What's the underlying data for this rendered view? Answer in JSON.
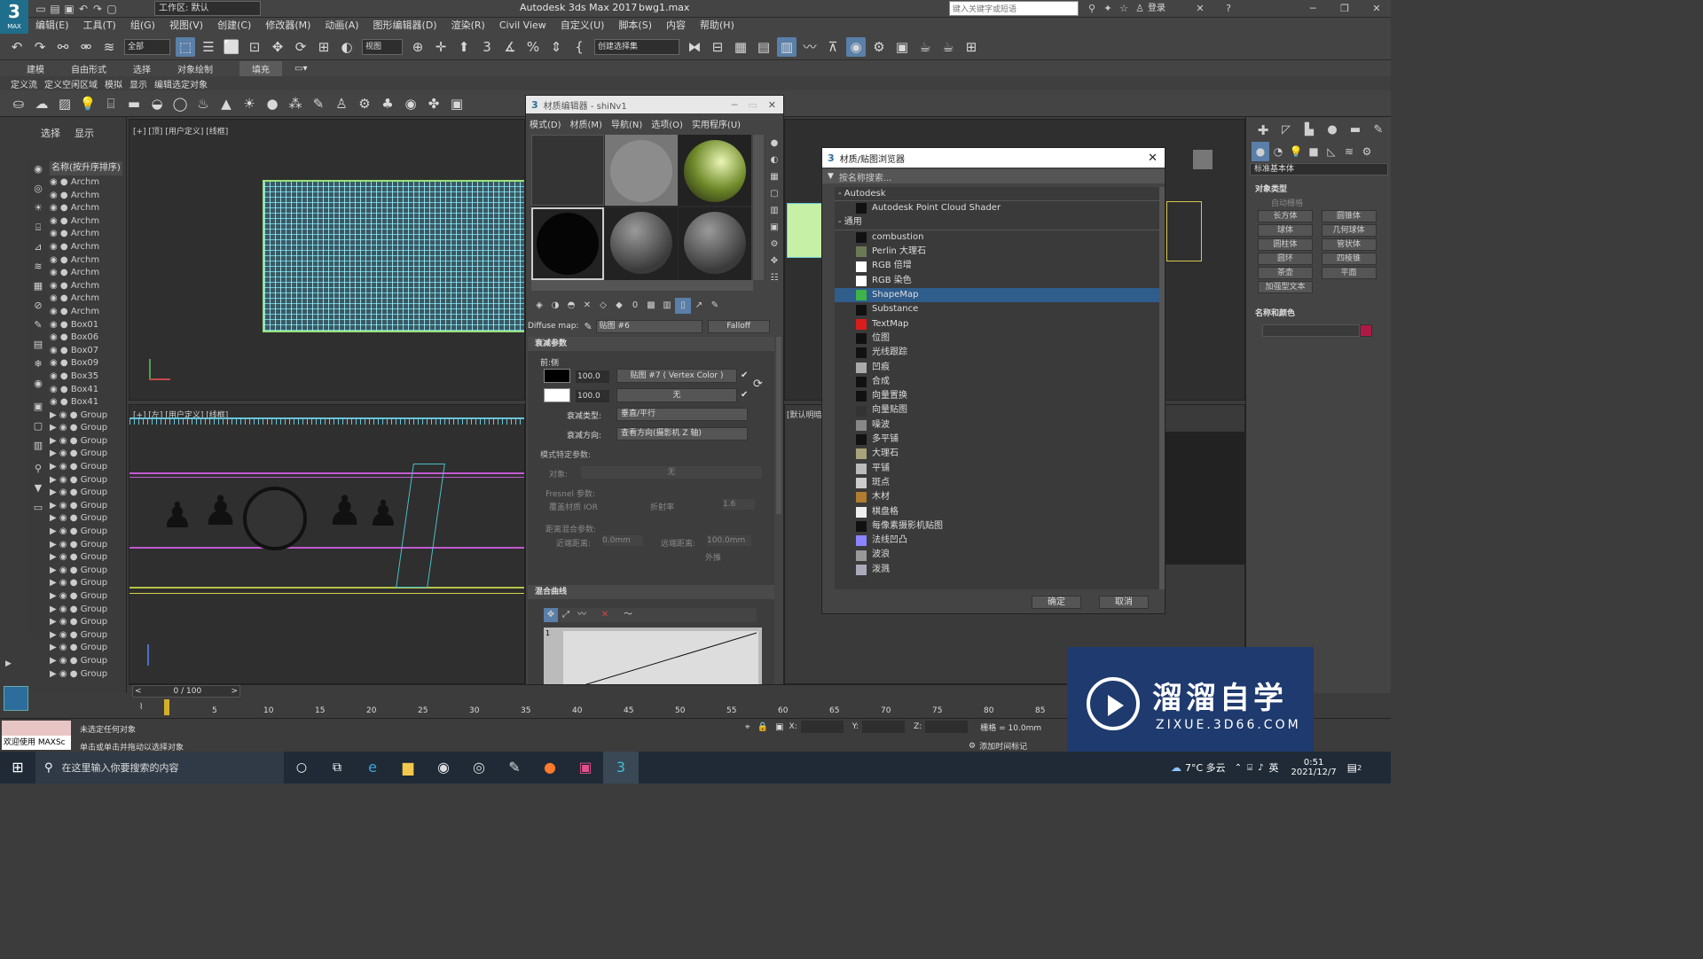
{
  "app": {
    "logo": "3",
    "logo_sub": "MAX",
    "workspace": "工作区: 默认",
    "title": "Autodesk 3ds Max 2017",
    "file": "bwg1.max",
    "search_placeholder": "键入关键字或短语",
    "login": "登录"
  },
  "menu": [
    "编辑(E)",
    "工具(T)",
    "组(G)",
    "视图(V)",
    "创建(C)",
    "修改器(M)",
    "动画(A)",
    "图形编辑器(D)",
    "渲染(R)",
    "Civil View",
    "自定义(U)",
    "脚本(S)",
    "内容",
    "帮助(H)"
  ],
  "toolbar": {
    "filter": "全部",
    "viewref": "视图",
    "selset": "创建选择集"
  },
  "ribbon_tabs": [
    "建模",
    "自由形式",
    "选择",
    "对象绘制",
    "填充"
  ],
  "ribbon_sub": [
    "定义流",
    "定义空闲区域",
    "模拟",
    "显示",
    "编辑选定对象"
  ],
  "scene": {
    "tabs": [
      "选择",
      "显示"
    ],
    "header": "名称(按升序排序)",
    "items": [
      "Archm",
      "Archm",
      "Archm",
      "Archm",
      "Archm",
      "Archm",
      "Archm",
      "Archm",
      "Archm",
      "Archm",
      "Archm",
      "Box01",
      "Box06",
      "Box07",
      "Box09",
      "Box35",
      "Box41",
      "Box41",
      "Group",
      "Group",
      "Group",
      "Group",
      "Group",
      "Group",
      "Group",
      "Group",
      "Group",
      "Group",
      "Group",
      "Group",
      "Group",
      "Group",
      "Group",
      "Group",
      "Group",
      "Group",
      "Group",
      "Group",
      "Group",
      "Grou"
    ]
  },
  "viewports": {
    "top_label": "[+] [顶] [用户定义] [线框]",
    "front_label": "[+] [左] [用户定义] [线框]",
    "persp_label": "[默认明暗处"
  },
  "mat_editor": {
    "title": "材质编辑器 - shiNv1",
    "menus": [
      "模式(D)",
      "材质(M)",
      "导航(N)",
      "选项(O)",
      "实用程序(U)"
    ],
    "diffuse_label": "Diffuse map:",
    "map_name": "贴图 #6",
    "map_type": "Falloff",
    "rollout1": "衰减参数",
    "front_side": "前:侧",
    "amt1": "100.0",
    "map1": "贴图 #7 ( Vertex Color )",
    "amt2": "100.0",
    "map2": "无",
    "falloff_type_label": "衰减类型:",
    "falloff_type": "垂直/平行",
    "falloff_dir_label": "衰减方向:",
    "falloff_dir": "查看方向(摄影机 Z 轴)",
    "mode_params": "模式特定参数:",
    "object_label": "对象:",
    "object_val": "无",
    "fresnel": "Fresnel 参数:",
    "override_ior": "覆盖材质 IOR",
    "ior_label": "折射率",
    "ior_val": "1.6",
    "dist_blend": "距离混合参数:",
    "near_label": "近端距离:",
    "near_val": "0.0mm",
    "far_label": "远端距离:",
    "far_val": "100.0mm",
    "extrapolate": "外推",
    "rollout2": "混合曲线",
    "curve_y": "1"
  },
  "browser": {
    "title": "材质/贴图浏览器",
    "search": "按名称搜索...",
    "groups": [
      {
        "name": "Autodesk",
        "items": [
          {
            "label": "Autodesk Point Cloud Shader",
            "color": "#111"
          }
        ]
      },
      {
        "name": "通用",
        "items": [
          {
            "label": "combustion",
            "color": "#111"
          },
          {
            "label": "Perlin 大理石",
            "color": "#6b7a55"
          },
          {
            "label": "RGB 倍增",
            "color": "#fff"
          },
          {
            "label": "RGB 染色",
            "color": "#fff"
          },
          {
            "label": "ShapeMap",
            "color": "#3db34a"
          },
          {
            "label": "Substance",
            "color": "#111"
          },
          {
            "label": "TextMap",
            "color": "#d91c1c"
          },
          {
            "label": "位图",
            "color": "#111"
          },
          {
            "label": "光线跟踪",
            "color": "#111"
          },
          {
            "label": "凹痕",
            "color": "#aaa"
          },
          {
            "label": "合成",
            "color": "#111"
          },
          {
            "label": "向量置换",
            "color": "#111"
          },
          {
            "label": "向量贴图",
            "color": "#333"
          },
          {
            "label": "噪波",
            "color": "#888"
          },
          {
            "label": "多平铺",
            "color": "#111"
          },
          {
            "label": "大理石",
            "color": "#a7a37a"
          },
          {
            "label": "平铺",
            "color": "#bbb"
          },
          {
            "label": "斑点",
            "color": "#ccc"
          },
          {
            "label": "木材",
            "color": "#b07c30"
          },
          {
            "label": "棋盘格",
            "color": "#eee"
          },
          {
            "label": "每像素摄影机贴图",
            "color": "#111"
          },
          {
            "label": "法线凹凸",
            "color": "#8a85ff"
          },
          {
            "label": "波浪",
            "color": "#999"
          },
          {
            "label": "泼溅",
            "color": "#aab"
          }
        ]
      }
    ],
    "ok": "确定",
    "cancel": "取消"
  },
  "cmd": {
    "dropdown": "标准基本体",
    "rollout1": "对象类型",
    "autogrid": "自动栅格",
    "buttons": [
      "长方体",
      "圆锥体",
      "球体",
      "几何球体",
      "圆柱体",
      "管状体",
      "圆环",
      "四棱锥",
      "茶壶",
      "平面",
      "加强型文本"
    ],
    "rollout2": "名称和颜色",
    "color": "#b01845"
  },
  "timeline": {
    "frame": "0 / 100",
    "ticks": [
      "5",
      "10",
      "15",
      "20",
      "25",
      "30",
      "35",
      "40",
      "45",
      "50",
      "55",
      "60",
      "65",
      "70",
      "75",
      "80",
      "85"
    ]
  },
  "status": {
    "maxscript": "欢迎使用 MAXSc",
    "msg1": "未选定任何对象",
    "msg2": "单击或单击并拖动以选择对象",
    "x": "X:",
    "y": "Y:",
    "z": "Z:",
    "grid": "栅格 = 10.0mm",
    "addtime": "添加时间标记"
  },
  "taskbar": {
    "search": "在这里输入你要搜索的内容",
    "weather": "7°C 多云",
    "lang": "英",
    "time": "0:51",
    "date": "2021/12/7",
    "notify": "2"
  },
  "watermark": {
    "brand": "溜溜自学",
    "url": "ZIXUE.3D66.COM"
  }
}
